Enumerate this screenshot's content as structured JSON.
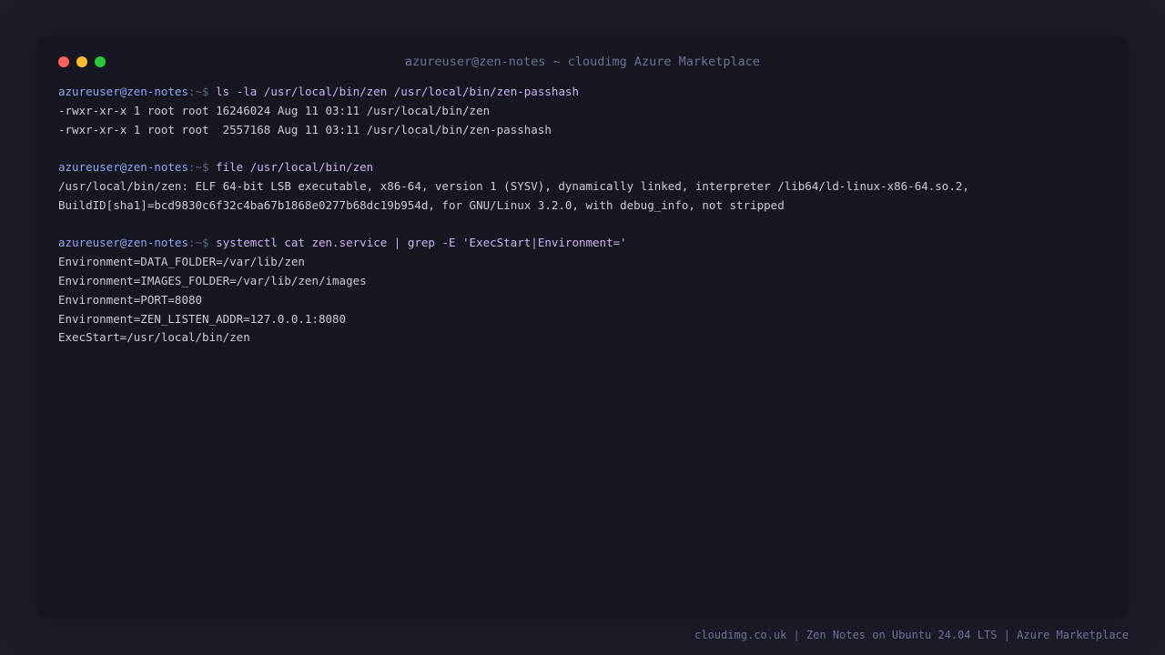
{
  "window": {
    "title": "azureuser@zen-notes ~ cloudimg Azure Marketplace",
    "buttons": {
      "close_color": "#ff5f57",
      "minimize_color": "#febc2e",
      "maximize_color": "#28c840"
    }
  },
  "terminal": {
    "blocks": [
      {
        "prompt_user": "azureuser@zen-notes",
        "prompt_sep": ":~$ ",
        "command": "ls -la /usr/local/bin/zen /usr/local/bin/zen-passhash",
        "output": [
          "-rwxr-xr-x 1 root root 16246024 Aug 11 03:11 /usr/local/bin/zen",
          "-rwxr-xr-x 1 root root  2557168 Aug 11 03:11 /usr/local/bin/zen-passhash"
        ]
      },
      {
        "prompt_user": "azureuser@zen-notes",
        "prompt_sep": ":~$ ",
        "command": "file /usr/local/bin/zen",
        "output": [
          "/usr/local/bin/zen: ELF 64-bit LSB executable, x86-64, version 1 (SYSV), dynamically linked, interpreter /lib64/ld-linux-x86-64.so.2,",
          "BuildID[sha1]=bcd9830c6f32c4ba67b1868e0277b68dc19b954d, for GNU/Linux 3.2.0, with debug_info, not stripped"
        ]
      },
      {
        "prompt_user": "azureuser@zen-notes",
        "prompt_sep": ":~$ ",
        "command": "systemctl cat zen.service | grep -E 'ExecStart|Environment='",
        "output": [
          "Environment=DATA_FOLDER=/var/lib/zen",
          "Environment=IMAGES_FOLDER=/var/lib/zen/images",
          "Environment=PORT=8080",
          "Environment=ZEN_LISTEN_ADDR=127.0.0.1:8080",
          "ExecStart=/usr/local/bin/zen"
        ]
      }
    ]
  },
  "footer": {
    "text": "cloudimg.co.uk | Zen Notes on Ubuntu 24.04 LTS | Azure Marketplace"
  }
}
